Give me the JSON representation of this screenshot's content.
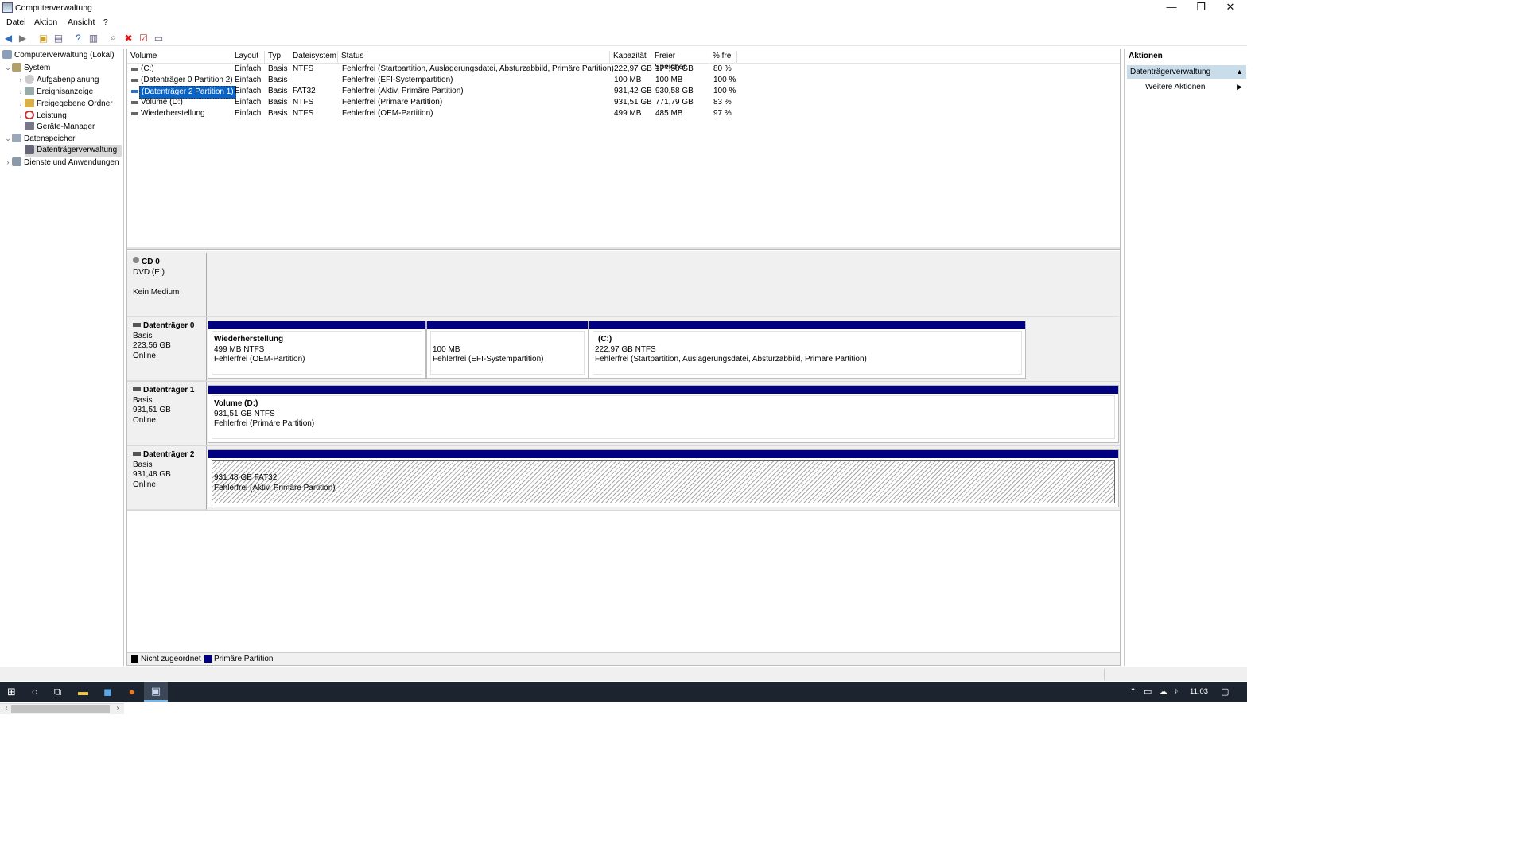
{
  "window": {
    "title": "Computerverwaltung",
    "controls": [
      "—",
      "❐",
      "✕"
    ]
  },
  "menu": [
    "Datei",
    "Aktion",
    "Ansicht",
    "?"
  ],
  "tree": [
    {
      "label": "Computerverwaltung (Lokal)",
      "level": 0
    },
    {
      "label": "System",
      "level": 1,
      "expanded": true
    },
    {
      "label": "Aufgabenplanung",
      "level": 2
    },
    {
      "label": "Ereignisanzeige",
      "level": 2
    },
    {
      "label": "Freigegebene Ordner",
      "level": 2
    },
    {
      "label": "Leistung",
      "level": 2
    },
    {
      "label": "Geräte-Manager",
      "level": 2
    },
    {
      "label": "Datenspeicher",
      "level": 1,
      "expanded": true
    },
    {
      "label": "Datenträgerverwaltung",
      "level": 2,
      "selected": true
    },
    {
      "label": "Dienste und Anwendungen",
      "level": 1
    }
  ],
  "volume_table": {
    "columns": [
      "Volume",
      "Layout",
      "Typ",
      "Dateisystem",
      "Status",
      "Kapazität",
      "Freier Speicher",
      "% frei"
    ],
    "rows": [
      [
        "(C:)",
        "Einfach",
        "Basis",
        "NTFS",
        "Fehlerfrei (Startpartition, Auslagerungsdatei, Absturzabbild, Primäre Partition)",
        "222,97 GB",
        "177,58 GB",
        "80 %"
      ],
      [
        "(Datenträger 0 Partition 2)",
        "Einfach",
        "Basis",
        "",
        "Fehlerfrei (EFI-Systempartition)",
        "100 MB",
        "100 MB",
        "100 %"
      ],
      [
        "(Datenträger 2 Partition 1)",
        "Einfach",
        "Basis",
        "FAT32",
        "Fehlerfrei (Aktiv, Primäre Partition)",
        "931,42 GB",
        "930,58 GB",
        "100 %"
      ],
      [
        "Volume (D:)",
        "Einfach",
        "Basis",
        "NTFS",
        "Fehlerfrei (Primäre Partition)",
        "931,51 GB",
        "771,79 GB",
        "83 %"
      ],
      [
        "Wiederherstellung",
        "Einfach",
        "Basis",
        "NTFS",
        "Fehlerfrei (OEM-Partition)",
        "499 MB",
        "485 MB",
        "97 %"
      ]
    ]
  },
  "disks": [
    {
      "name": "CD 0",
      "line1": "DVD (E:)",
      "line2": "",
      "line3": "Kein Medium",
      "partitions": []
    },
    {
      "name": "Datenträger 0",
      "line1": "Basis",
      "line2": "223,56 GB",
      "line3": "Online",
      "partitions": [
        {
          "title": "Wiederherstellung",
          "size": "499 MB NTFS",
          "status": "Fehlerfrei (OEM-Partition)"
        },
        {
          "title": "",
          "size": "100 MB",
          "status": "Fehlerfrei (EFI-Systempartition)"
        },
        {
          "title": "(C:)",
          "size": "222,97 GB NTFS",
          "status": "Fehlerfrei (Startpartition, Auslagerungsdatei, Absturzabbild, Primäre Partition)"
        }
      ]
    },
    {
      "name": "Datenträger 1",
      "line1": "Basis",
      "line2": "931,51 GB",
      "line3": "Online",
      "partitions": [
        {
          "title": "Volume  (D:)",
          "size": "931,51 GB NTFS",
          "status": "Fehlerfrei (Primäre Partition)"
        }
      ]
    },
    {
      "name": "Datenträger 2",
      "line1": "Basis",
      "line2": "931,48 GB",
      "line3": "Online",
      "partitions": [
        {
          "title": "",
          "size": "931,48 GB FAT32",
          "status": "Fehlerfrei (Aktiv, Primäre Partition)"
        }
      ]
    }
  ],
  "legend": {
    "unallocated": "Nicht zugeordnet",
    "primary": "Primäre Partition",
    "unallocated_color": "#000000",
    "primary_color": "#000080"
  },
  "actions": {
    "header": "Aktionen",
    "section": "Datenträgerverwaltung",
    "item": "Weitere Aktionen"
  },
  "clock": "11:03",
  "colors": {
    "selection": "#0a64c8",
    "partition_bar": "#000080",
    "action_section": "#c9dcea",
    "taskbar": "#1c2430"
  }
}
